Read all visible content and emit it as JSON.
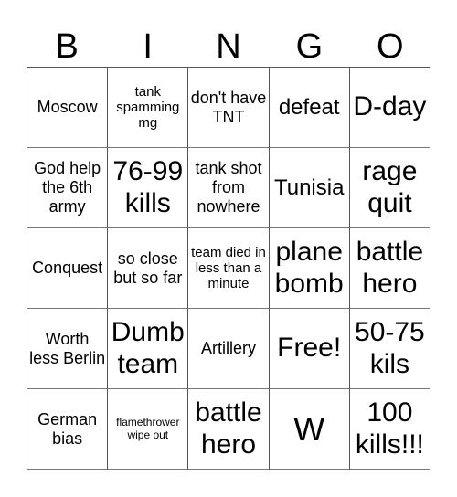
{
  "header": [
    "B",
    "I",
    "N",
    "G",
    "O"
  ],
  "cells": [
    {
      "text": "Moscow",
      "size": "md"
    },
    {
      "text": "tank spamming mg",
      "size": "sm"
    },
    {
      "text": "don't have TNT",
      "size": "md"
    },
    {
      "text": "defeat",
      "size": "lg"
    },
    {
      "text": "D-day",
      "size": "xl"
    },
    {
      "text": "God help the 6th army",
      "size": "md"
    },
    {
      "text": "76-99 kills",
      "size": "xl"
    },
    {
      "text": "tank shot from nowhere",
      "size": "md"
    },
    {
      "text": "Tunisia",
      "size": "lg"
    },
    {
      "text": "rage quit",
      "size": "xl"
    },
    {
      "text": "Conquest",
      "size": "md"
    },
    {
      "text": "so close but so far",
      "size": "md"
    },
    {
      "text": "team died in less than a minute",
      "size": "sm"
    },
    {
      "text": "plane bomb",
      "size": "xl"
    },
    {
      "text": "battle hero",
      "size": "xl"
    },
    {
      "text": "Worth less Berlin",
      "size": "md"
    },
    {
      "text": "Dumb team",
      "size": "xl"
    },
    {
      "text": "Artillery",
      "size": "md"
    },
    {
      "text": "Free!",
      "size": "xl"
    },
    {
      "text": "50-75 kils",
      "size": "xl"
    },
    {
      "text": "German bias",
      "size": "md"
    },
    {
      "text": "flamethrower wipe out",
      "size": "xs"
    },
    {
      "text": "battle hero",
      "size": "xl"
    },
    {
      "text": "W",
      "size": "xxl"
    },
    {
      "text": "100 kills!!!",
      "size": "xl"
    }
  ]
}
